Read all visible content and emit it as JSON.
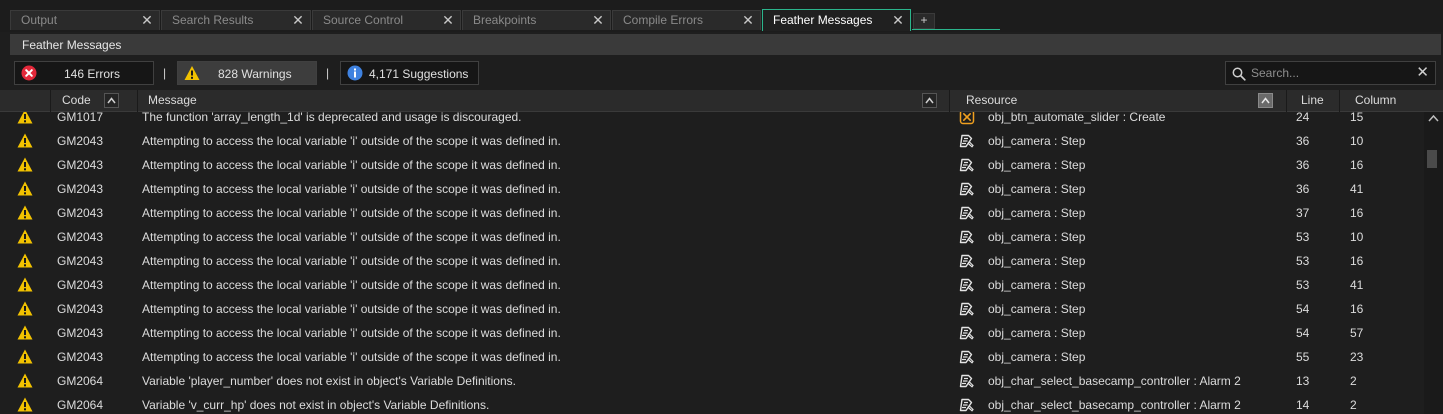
{
  "tabs": [
    {
      "label": "Output",
      "active": false
    },
    {
      "label": "Search Results",
      "active": false
    },
    {
      "label": "Source Control",
      "active": false
    },
    {
      "label": "Breakpoints",
      "active": false
    },
    {
      "label": "Compile Errors",
      "active": false
    },
    {
      "label": "Feather Messages",
      "active": true
    }
  ],
  "tab_add_label": "+",
  "panel_title": "Feather Messages",
  "filters": {
    "errors": {
      "label": "146 Errors",
      "icon": "error-circle-icon",
      "color": "#e2283a"
    },
    "warnings": {
      "label": "828 Warnings",
      "icon": "warning-triangle-icon",
      "color": "#f2c200"
    },
    "suggestions": {
      "label": "4,171 Suggestions",
      "icon": "info-circle-icon",
      "color": "#3f82e0"
    },
    "separator": "|"
  },
  "search": {
    "placeholder": "Search...",
    "value": ""
  },
  "columns": {
    "code": "Code",
    "message": "Message",
    "resource": "Resource",
    "line": "Line",
    "column": "Column"
  },
  "rows": [
    {
      "type": "warning",
      "code": "GM1017",
      "message": "The function 'array_length_1d' is deprecated and usage is discouraged.",
      "resource_icon": "object-event-icon",
      "resource": "obj_btn_automate_slider : Create",
      "line": "24",
      "column": "15"
    },
    {
      "type": "warning",
      "code": "GM2043",
      "message": "Attempting to access the local variable 'i' outside of the scope it was defined in.",
      "resource_icon": "script-icon",
      "resource": "obj_camera : Step",
      "line": "36",
      "column": "10"
    },
    {
      "type": "warning",
      "code": "GM2043",
      "message": "Attempting to access the local variable 'i' outside of the scope it was defined in.",
      "resource_icon": "script-icon",
      "resource": "obj_camera : Step",
      "line": "36",
      "column": "16"
    },
    {
      "type": "warning",
      "code": "GM2043",
      "message": "Attempting to access the local variable 'i' outside of the scope it was defined in.",
      "resource_icon": "script-icon",
      "resource": "obj_camera : Step",
      "line": "36",
      "column": "41"
    },
    {
      "type": "warning",
      "code": "GM2043",
      "message": "Attempting to access the local variable 'i' outside of the scope it was defined in.",
      "resource_icon": "script-icon",
      "resource": "obj_camera : Step",
      "line": "37",
      "column": "16"
    },
    {
      "type": "warning",
      "code": "GM2043",
      "message": "Attempting to access the local variable 'i' outside of the scope it was defined in.",
      "resource_icon": "script-icon",
      "resource": "obj_camera : Step",
      "line": "53",
      "column": "10"
    },
    {
      "type": "warning",
      "code": "GM2043",
      "message": "Attempting to access the local variable 'i' outside of the scope it was defined in.",
      "resource_icon": "script-icon",
      "resource": "obj_camera : Step",
      "line": "53",
      "column": "16"
    },
    {
      "type": "warning",
      "code": "GM2043",
      "message": "Attempting to access the local variable 'i' outside of the scope it was defined in.",
      "resource_icon": "script-icon",
      "resource": "obj_camera : Step",
      "line": "53",
      "column": "41"
    },
    {
      "type": "warning",
      "code": "GM2043",
      "message": "Attempting to access the local variable 'i' outside of the scope it was defined in.",
      "resource_icon": "script-icon",
      "resource": "obj_camera : Step",
      "line": "54",
      "column": "16"
    },
    {
      "type": "warning",
      "code": "GM2043",
      "message": "Attempting to access the local variable 'i' outside of the scope it was defined in.",
      "resource_icon": "script-icon",
      "resource": "obj_camera : Step",
      "line": "54",
      "column": "57"
    },
    {
      "type": "warning",
      "code": "GM2043",
      "message": "Attempting to access the local variable 'i' outside of the scope it was defined in.",
      "resource_icon": "script-icon",
      "resource": "obj_camera : Step",
      "line": "55",
      "column": "23"
    },
    {
      "type": "warning",
      "code": "GM2064",
      "message": "Variable 'player_number' does not exist in object's Variable Definitions.",
      "resource_icon": "script-icon",
      "resource": "obj_char_select_basecamp_controller : Alarm 2",
      "line": "13",
      "column": "2"
    },
    {
      "type": "warning",
      "code": "GM2064",
      "message": "Variable 'v_curr_hp' does not exist in object's Variable Definitions.",
      "resource_icon": "script-icon",
      "resource": "obj_char_select_basecamp_controller : Alarm 2",
      "line": "14",
      "column": "2"
    }
  ]
}
